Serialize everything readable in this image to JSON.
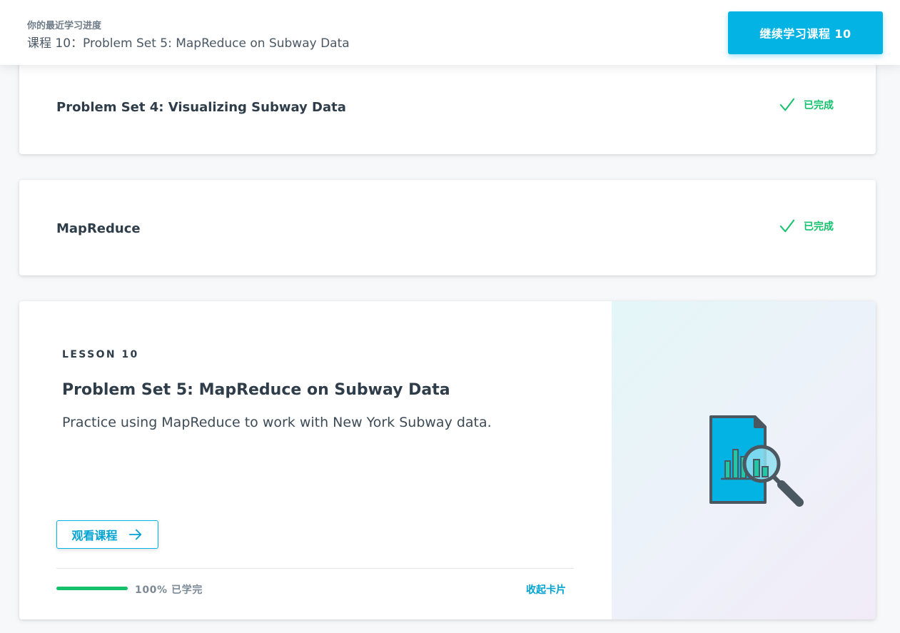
{
  "header": {
    "kicker": "你的最近学习进度",
    "current_lesson": "课程 10：Problem Set 5: MapReduce on Subway Data",
    "continue_button": "继续学习课程 10"
  },
  "completed_lessons": [
    {
      "title": "Problem Set 4: Visualizing Subway Data",
      "status": "已完成"
    },
    {
      "title": "MapReduce",
      "status": "已完成"
    }
  ],
  "lesson_card": {
    "eyebrow": "LESSON 10",
    "title": "Problem Set 5: MapReduce on Subway Data",
    "description": "Practice using MapReduce to work with New York Subway data.",
    "view_button": "观看课程",
    "progress_fraction": 1.0,
    "progress_text": "100% 已学完",
    "collapse_link": "收起卡片",
    "illustration_icon": "document-chart-magnifier-icon"
  },
  "colors": {
    "accent": "#02b3e4",
    "success": "#15c26b",
    "text": "#2e3d49"
  }
}
